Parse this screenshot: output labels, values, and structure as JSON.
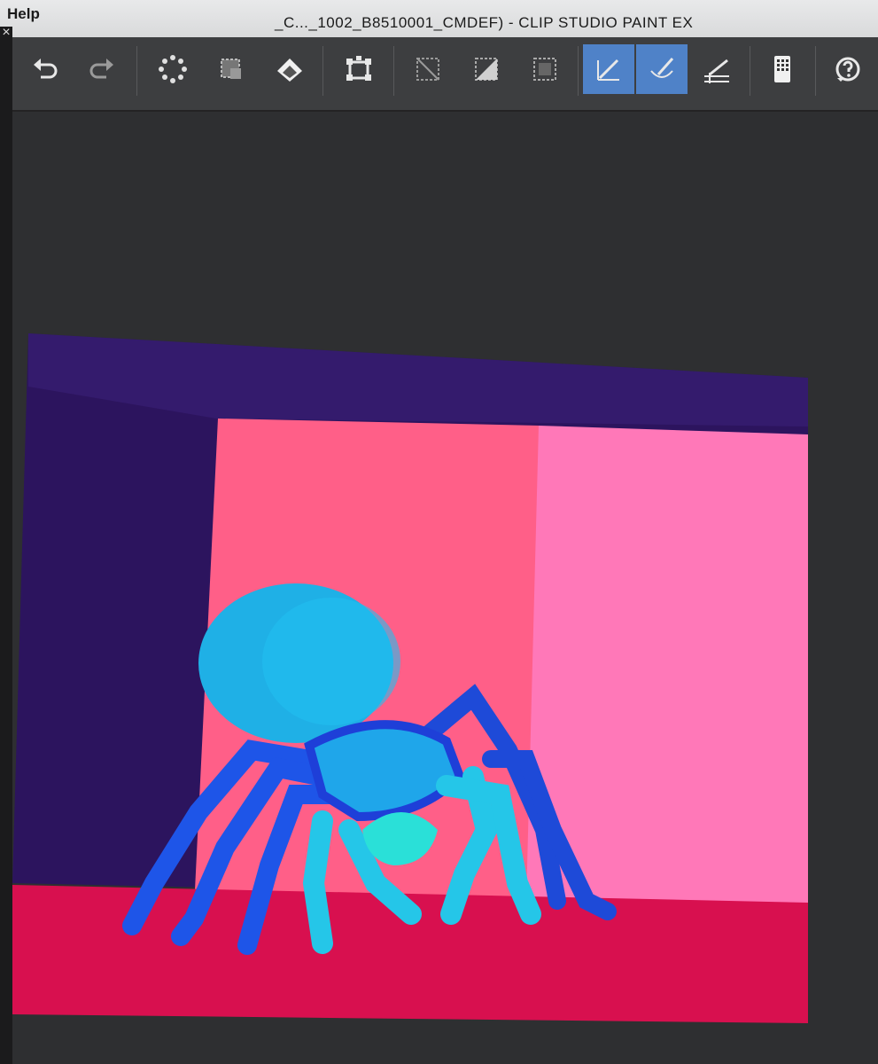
{
  "window": {
    "menu_help": "Help",
    "title": "_C..._1002_B8510001_CMDEF)  - CLIP STUDIO PAINT EX",
    "close_glyph": "×"
  },
  "toolbar": {
    "tools": [
      {
        "name": "undo-icon",
        "active": false
      },
      {
        "name": "redo-icon",
        "active": false
      },
      {
        "name": "loading-icon",
        "active": false
      },
      {
        "name": "clear-selection-icon",
        "active": false
      },
      {
        "name": "fill-icon",
        "active": false
      },
      {
        "name": "transform-icon",
        "active": false
      },
      {
        "name": "deselect-icon",
        "active": false
      },
      {
        "name": "invert-selection-icon",
        "active": false
      },
      {
        "name": "select-all-icon",
        "active": false
      },
      {
        "name": "ruler-snap-icon",
        "active": true
      },
      {
        "name": "brush-snap-icon",
        "active": true
      },
      {
        "name": "perspective-snap-icon",
        "active": false
      },
      {
        "name": "tablet-icon",
        "active": false
      },
      {
        "name": "help-icon",
        "active": false
      }
    ]
  },
  "colors": {
    "toolbar_bg": "#3d3e40",
    "active_tool": "#4f82c8",
    "wall_dark": "#2c145e",
    "box_left": "#ff5f88",
    "box_right": "#ff78b8",
    "floor": "#d8104f",
    "spider_body": "#1fb0e6",
    "spider_legs": "#1e55e8"
  }
}
